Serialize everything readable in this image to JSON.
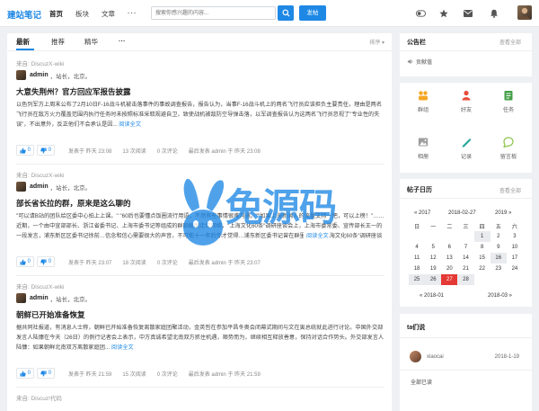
{
  "header": {
    "logo": "建站笔记",
    "nav": [
      "首页",
      "板块",
      "文章"
    ],
    "nav_more": "···",
    "search_placeholder": "搜索你感兴趣的内容...",
    "post_button": "发帖"
  },
  "feed": {
    "tabs": [
      "最新",
      "推荐",
      "精华"
    ],
    "tabs_more": "···",
    "sort_label": "排序 ▾",
    "posts": [
      {
        "source": "来自: DiscuzX-wiki",
        "author": "admin",
        "author_meta": "，站长，北京。",
        "title": "大意失荆州？官方回应军报告披露",
        "excerpt": "以色列军方上周末公布了2月10日F-16战斗机被击落事件的事故调查报告，报告认为，当事F-16战斗机上的两名飞行员应该担负主要责任，理由是两名飞行员在敌方火力覆盖范围内执行任务时未按照标准采取规避自卫，致使战机被敌防空导弹击落，以军调查报告认为这两名飞行员忽视了\"专业性的失误\"，不出意外，反正他们不会承认是因...",
        "read_all": "阅读全文",
        "like": "0",
        "dislike": "0",
        "posted": "发表于 昨天 23:08",
        "views": "13 次阅读",
        "comments": "0 次评论",
        "last_reply": "最后发表 admin 于 昨天 23:08"
      },
      {
        "source": "来自: DiscuzX-wiki",
        "author": "admin",
        "author_meta": "，站长，北京。",
        "title": "部长省长拉的群，原来是这么聊的",
        "excerpt": "\"可以请B站的团队给区委中心拍上上课。\" \"60后也要懂点饭圈流行用语，不然有些事情很难沟通。\"\"如果上海新闻人的流量支持一把，可以上榜！\"……近期，一个由中宣部部长、浙江省委书记、上海市委书记等组成的群聊截图走红网络，\"上海文化60条\"调研座谈会上，上海市委常委、宣传部长王一的一段发言，浦东新区区委书记徐前…信念和信心需要很大的声音，不可能十一年后你才觉得…浦东新区委书记曾在群里发言、\"上海文化60条\"调研座谈会的时间线…宣传部长陈…好，今年全国网民1/3约90后谈联在B站，统计数据显示，B站是24岁及以下年轻用户最喜爱的A...",
        "read_all": "阅读全文",
        "like": "0",
        "dislike": "0",
        "posted": "发表于 昨天 23:07",
        "views": "18 次阅读",
        "comments": "0 次评论",
        "last_reply": "最后发表 admin 于 昨天 23:07"
      },
      {
        "source": "来自: DiscuzX-wiki",
        "author": "admin",
        "author_meta": "，站长，北京。",
        "title": "朝鲜已开始准备恢复",
        "excerpt": "据共同社报道，有消息人士称，朝鲜已开始准备恢复离散家庭团聚活动，金英哲在参加平昌冬奥会闭幕式期间与文在寅总统就此进行讨论。中国外交部发言人陆慷在今天（26日）的例行记者会上表示，中方真诚希望北南双方抓住机遇，顺势而为，继续相互释放善意，保持对话合作势头。外交部发言人 陆慷：如果朝鲜北南双方离散家庭团...",
        "read_all": "阅读全文",
        "like": "0",
        "dislike": "0",
        "posted": "发表于 昨天 21:59",
        "views": "15 次阅读",
        "comments": "0 次评论",
        "last_reply": "最后发表 admin 于 昨天 21:59"
      },
      {
        "source": "来自: Discuz!代码"
      }
    ]
  },
  "notice": {
    "title": "公告栏",
    "more": "查看全部",
    "item": "贡献值"
  },
  "quick_links": [
    {
      "label": "群组",
      "icon": "group-icon",
      "color": "#f5a623"
    },
    {
      "label": "好友",
      "icon": "friend-icon",
      "color": "#e74c3c"
    },
    {
      "label": "任务",
      "icon": "task-icon",
      "color": "#43a047"
    },
    {
      "label": "相册",
      "icon": "album-icon",
      "color": "#8d8d8d"
    },
    {
      "label": "记录",
      "icon": "record-icon",
      "color": "#26a69a"
    },
    {
      "label": "留言板",
      "icon": "board-icon",
      "color": "#8bc34a"
    }
  ],
  "calendar": {
    "title": "帖子日历",
    "more": "查看全部",
    "prev_year": "« 2017",
    "current": "2018-02-27",
    "next_year": "2019 »",
    "weekdays": [
      "日",
      "一",
      "二",
      "三",
      "四",
      "五",
      "六"
    ],
    "weeks": [
      [
        "",
        "",
        "",
        "",
        "1",
        "2",
        "3"
      ],
      [
        "4",
        "5",
        "6",
        "7",
        "8",
        "9",
        "10"
      ],
      [
        "11",
        "12",
        "13",
        "14",
        "15",
        "16",
        "17"
      ],
      [
        "18",
        "19",
        "20",
        "21",
        "22",
        "23",
        "24"
      ],
      [
        "25",
        "26",
        "27",
        "28",
        "",
        "",
        ""
      ]
    ],
    "prev_month": "« 2018-01",
    "next_month": "2018-03 »"
  },
  "ta": {
    "title": "ta们说",
    "user": "xiaocai",
    "date": "2018-1-19",
    "all": "全部已读"
  },
  "watermark": {
    "text": "兔源码"
  }
}
